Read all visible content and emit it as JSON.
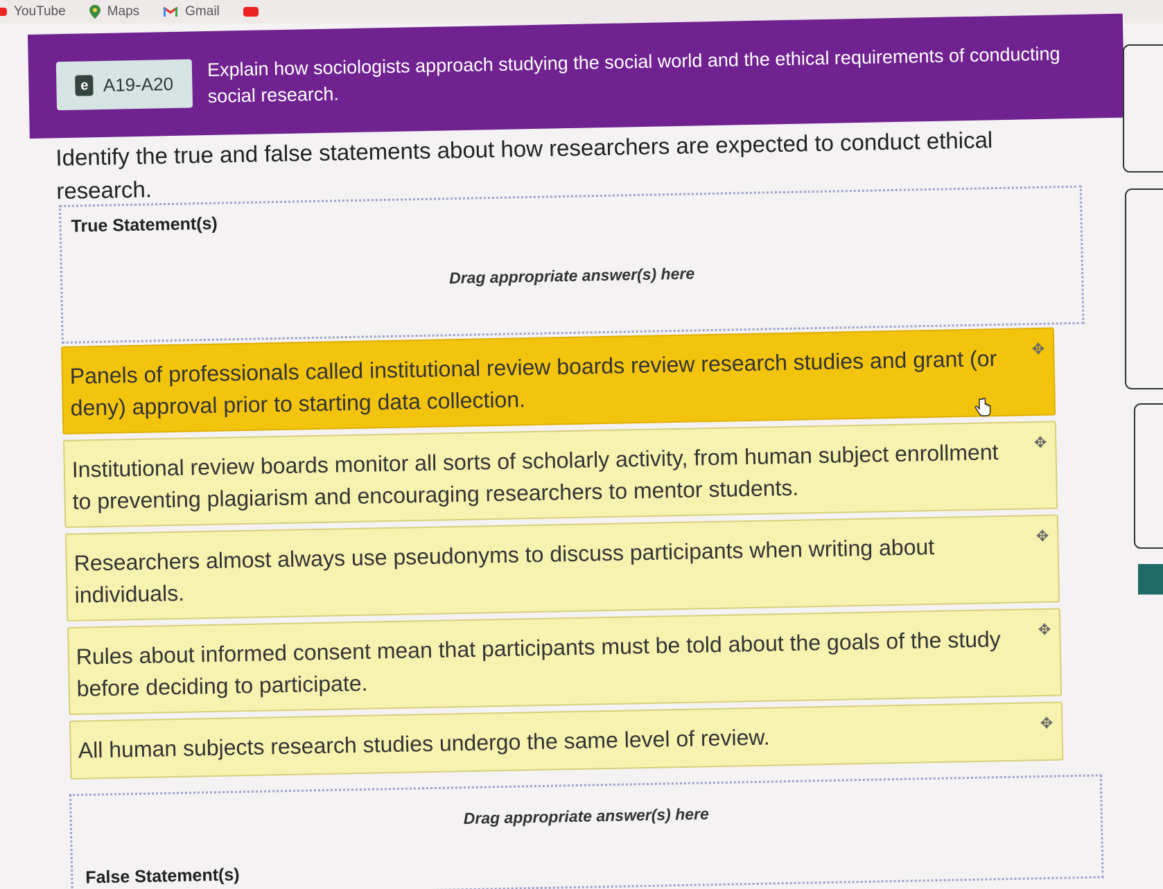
{
  "bookmarks": {
    "youtube": "YouTube",
    "maps": "Maps",
    "gmail": "Gmail"
  },
  "banner": {
    "badge": "A19-A20",
    "text": "Explain how sociologists approach studying the social world and the ethical requirements of conducting social research."
  },
  "instructions": "Identify the true and false statements about how researchers are expected to conduct ethical research.",
  "zones": {
    "true_title": "True Statement(s)",
    "true_hint": "Drag appropriate answer(s) here",
    "false_title": "False Statement(s)",
    "false_hint": "Drag appropriate answer(s) here"
  },
  "cards": [
    {
      "text": "Panels of professionals called institutional review boards review research studies and grant (or deny) approval prior to starting data collection."
    },
    {
      "text": "Institutional review boards monitor all sorts of scholarly activity, from human subject enrollment to preventing plagiarism and encouraging researchers to mentor students."
    },
    {
      "text": "Researchers almost always use pseudonyms to discuss participants when writing about individuals."
    },
    {
      "text": "Rules about informed consent mean that participants must be told about the goals of the study before deciding to participate."
    },
    {
      "text": "All human subjects research studies undergo the same level of review."
    }
  ],
  "colors": {
    "banner": "#6f2290",
    "selected_card": "#f2c40d",
    "card": "#f6f2b0"
  }
}
